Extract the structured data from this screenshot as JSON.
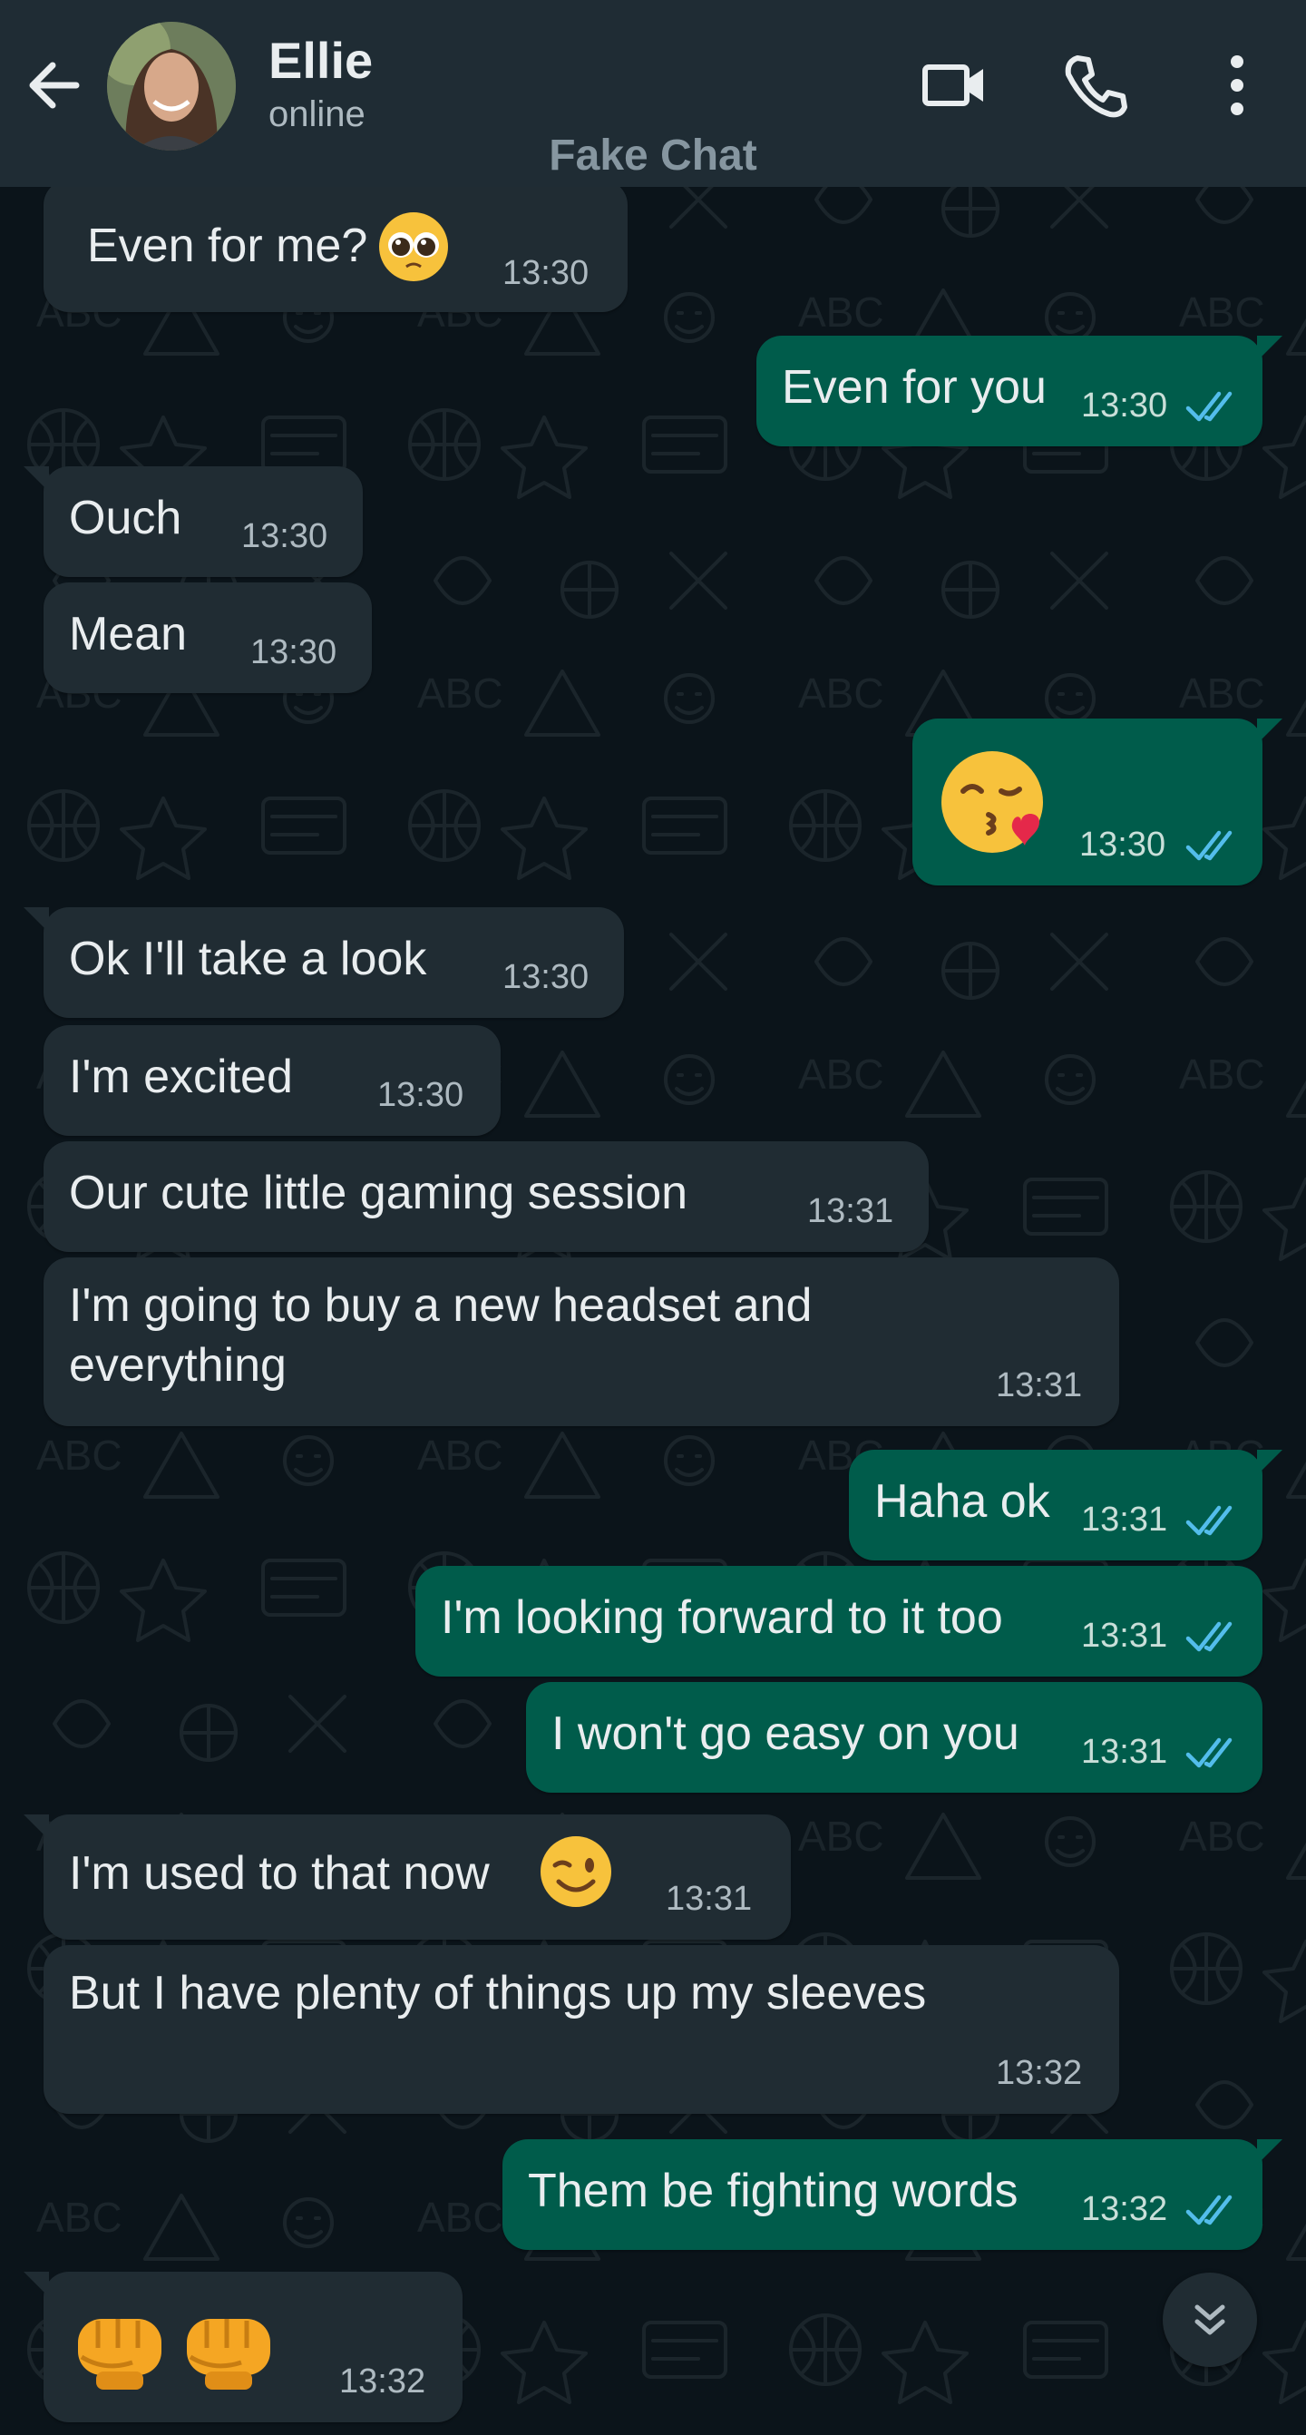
{
  "header": {
    "contact_name": "Ellie",
    "contact_status": "online",
    "brand_watermark": "Fake Chat"
  },
  "colors": {
    "background": "#0b141a",
    "header": "#1f2c34",
    "incoming_bubble": "#202c33",
    "outgoing_bubble": "#005c4b",
    "read_ticks": "#53bdeb"
  },
  "messages": [
    {
      "direction": "incoming",
      "text": "Even for me?",
      "emoji": "pleading-face",
      "time": "13:30"
    },
    {
      "direction": "outgoing",
      "text": "Even for you",
      "time": "13:30",
      "status": "read"
    },
    {
      "direction": "incoming",
      "text": "Ouch",
      "time": "13:30"
    },
    {
      "direction": "incoming",
      "text": "Mean",
      "time": "13:30"
    },
    {
      "direction": "outgoing",
      "text": "",
      "emoji": "face-blowing-a-kiss",
      "time": "13:30",
      "status": "read"
    },
    {
      "direction": "incoming",
      "text": "Ok I'll take a look",
      "time": "13:30"
    },
    {
      "direction": "incoming",
      "text": "I'm excited",
      "time": "13:30"
    },
    {
      "direction": "incoming",
      "text": "Our cute little gaming session",
      "time": "13:31"
    },
    {
      "direction": "incoming",
      "lines": [
        "I'm going to buy a new headset and",
        "everything"
      ],
      "time": "13:31"
    },
    {
      "direction": "outgoing",
      "text": "Haha ok",
      "time": "13:31",
      "status": "read"
    },
    {
      "direction": "outgoing",
      "text": "I'm looking forward to it too",
      "time": "13:31",
      "status": "read"
    },
    {
      "direction": "outgoing",
      "text": "I won't go easy on you",
      "time": "13:31",
      "status": "read"
    },
    {
      "direction": "incoming",
      "text": "I'm used to that now",
      "emoji": "winking-face",
      "time": "13:31"
    },
    {
      "direction": "incoming",
      "text": "But I have plenty of things up my sleeves",
      "time": "13:32"
    },
    {
      "direction": "outgoing",
      "text": "Them be fighting words",
      "time": "13:32",
      "status": "read"
    },
    {
      "direction": "incoming",
      "text": "",
      "emoji": "oncoming-fist x2",
      "time": "13:32"
    }
  ],
  "icons": {
    "back": "arrow-left-icon",
    "video_call": "video-camera-icon",
    "voice_call": "phone-icon",
    "menu": "more-vertical-icon",
    "scroll": "double-chevron-down-icon"
  }
}
